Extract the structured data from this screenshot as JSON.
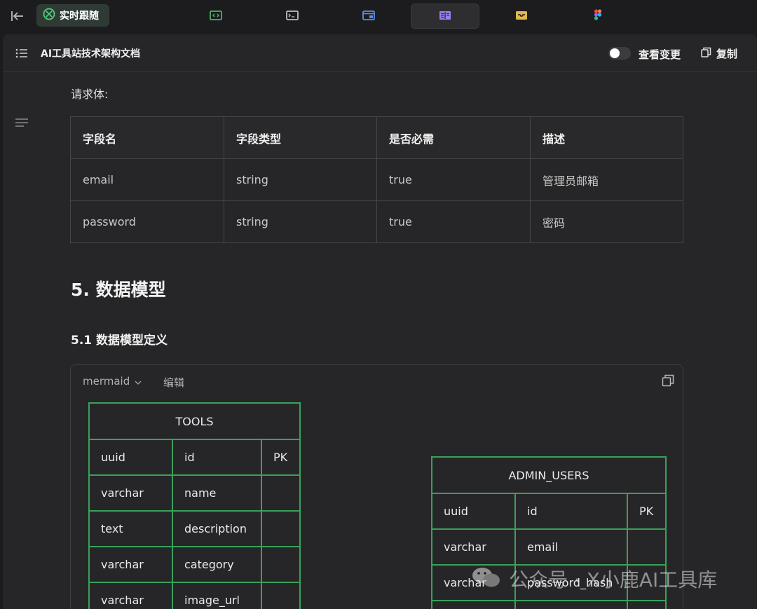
{
  "topbar": {
    "follow_label": "实时跟随",
    "tabs": [
      {
        "icon": "code-preview-icon",
        "color": "#3fb868"
      },
      {
        "icon": "terminal-icon",
        "color": "#bdbdbd"
      },
      {
        "icon": "browser-window-icon",
        "color": "#5b8def"
      },
      {
        "icon": "document-reader-icon",
        "color": "#9a7cf0",
        "active": true
      },
      {
        "icon": "inbox-icon",
        "color": "#e0b84a"
      },
      {
        "icon": "figma-icon",
        "color": "#f24e1e"
      }
    ]
  },
  "header": {
    "title": "AI工具站技术架构文档",
    "toggle_label": "查看变更",
    "toggle_on": false,
    "copy_label": "复制"
  },
  "content": {
    "request_body_label": "请求体:",
    "table": {
      "headers": [
        "字段名",
        "字段类型",
        "是否必需",
        "描述"
      ],
      "rows": [
        [
          "email",
          "string",
          "true",
          "管理员邮箱"
        ],
        [
          "password",
          "string",
          "true",
          "密码"
        ]
      ]
    },
    "h2": "5. 数据模型",
    "h3": "5.1 数据模型定义"
  },
  "mermaid": {
    "lang": "mermaid",
    "edit_label": "编辑",
    "tools": {
      "title": "TOOLS",
      "rows": [
        [
          "uuid",
          "id",
          "PK"
        ],
        [
          "varchar",
          "name",
          ""
        ],
        [
          "text",
          "description",
          ""
        ],
        [
          "varchar",
          "category",
          ""
        ],
        [
          "varchar",
          "image_url",
          ""
        ]
      ]
    },
    "admin_users": {
      "title": "ADMIN_USERS",
      "rows": [
        [
          "uuid",
          "id",
          "PK"
        ],
        [
          "varchar",
          "email",
          ""
        ],
        [
          "varchar",
          "password_hash",
          ""
        ],
        [
          "",
          "",
          ""
        ]
      ]
    },
    "border_color": "#3aa15a"
  },
  "watermark": "公众号 · X小鹿AI工具库"
}
